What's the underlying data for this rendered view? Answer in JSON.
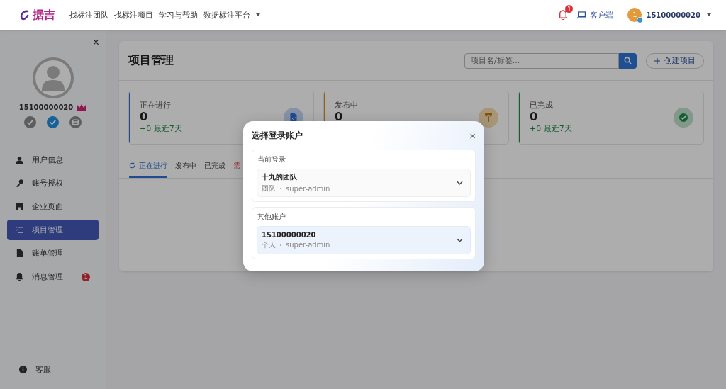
{
  "topbar": {
    "logo": "据吉",
    "nav": [
      {
        "label": "找标注团队",
        "dropdown": false
      },
      {
        "label": "找标注项目",
        "dropdown": false
      },
      {
        "label": "学习与帮助",
        "dropdown": false
      },
      {
        "label": "数据标注平台",
        "dropdown": true
      }
    ],
    "notification_count": "1",
    "client_label": "客户端",
    "avatar_initial": "1",
    "username": "15100000020"
  },
  "sidebar": {
    "close_label": "×",
    "username": "15100000020",
    "status_icons": [
      {
        "kind": "check",
        "on": false
      },
      {
        "kind": "check",
        "on": true
      },
      {
        "kind": "card",
        "on": false
      }
    ],
    "items": [
      {
        "label": "用户信息",
        "kind": "person",
        "selected": false
      },
      {
        "label": "账号授权",
        "kind": "key",
        "selected": false
      },
      {
        "label": "企业页面",
        "kind": "store",
        "selected": false
      },
      {
        "label": "项目管理",
        "kind": "list",
        "selected": true
      },
      {
        "label": "账单管理",
        "kind": "bill",
        "selected": false
      },
      {
        "label": "消息管理",
        "kind": "bell",
        "selected": false,
        "badge": "1"
      }
    ],
    "footer": "客服"
  },
  "page": {
    "title": "项目管理",
    "search": {
      "placeholder": "项目名/标签..."
    },
    "create_button": "创建项目",
    "stats": [
      {
        "label": "正在进行",
        "value": "0",
        "trend": "+0 最近7天",
        "kind": "doc"
      },
      {
        "label": "发布中",
        "value": "0",
        "kind": "upload"
      },
      {
        "label": "已完成",
        "value": "0",
        "trend": "+0 最近7天",
        "kind": "done"
      }
    ],
    "tabs": [
      {
        "label": "正在进行",
        "selected": true,
        "kind": "normal"
      },
      {
        "label": "发布中",
        "selected": false,
        "kind": "normal"
      },
      {
        "label": "已完成",
        "selected": false,
        "kind": "normal"
      },
      {
        "label": "需",
        "selected": false,
        "kind": "alert"
      }
    ]
  },
  "dialog": {
    "title": "选择登录账户",
    "close_label": "×",
    "sections": [
      {
        "heading": "当前登录",
        "accounts": [
          {
            "name": "十九的团队",
            "type": "团队",
            "role": "super-admin",
            "highlighted": false
          }
        ]
      },
      {
        "heading": "其他账户",
        "accounts": [
          {
            "name": "15100000020",
            "type": "个人",
            "role": "super-admin",
            "highlighted": true
          }
        ]
      }
    ]
  }
}
